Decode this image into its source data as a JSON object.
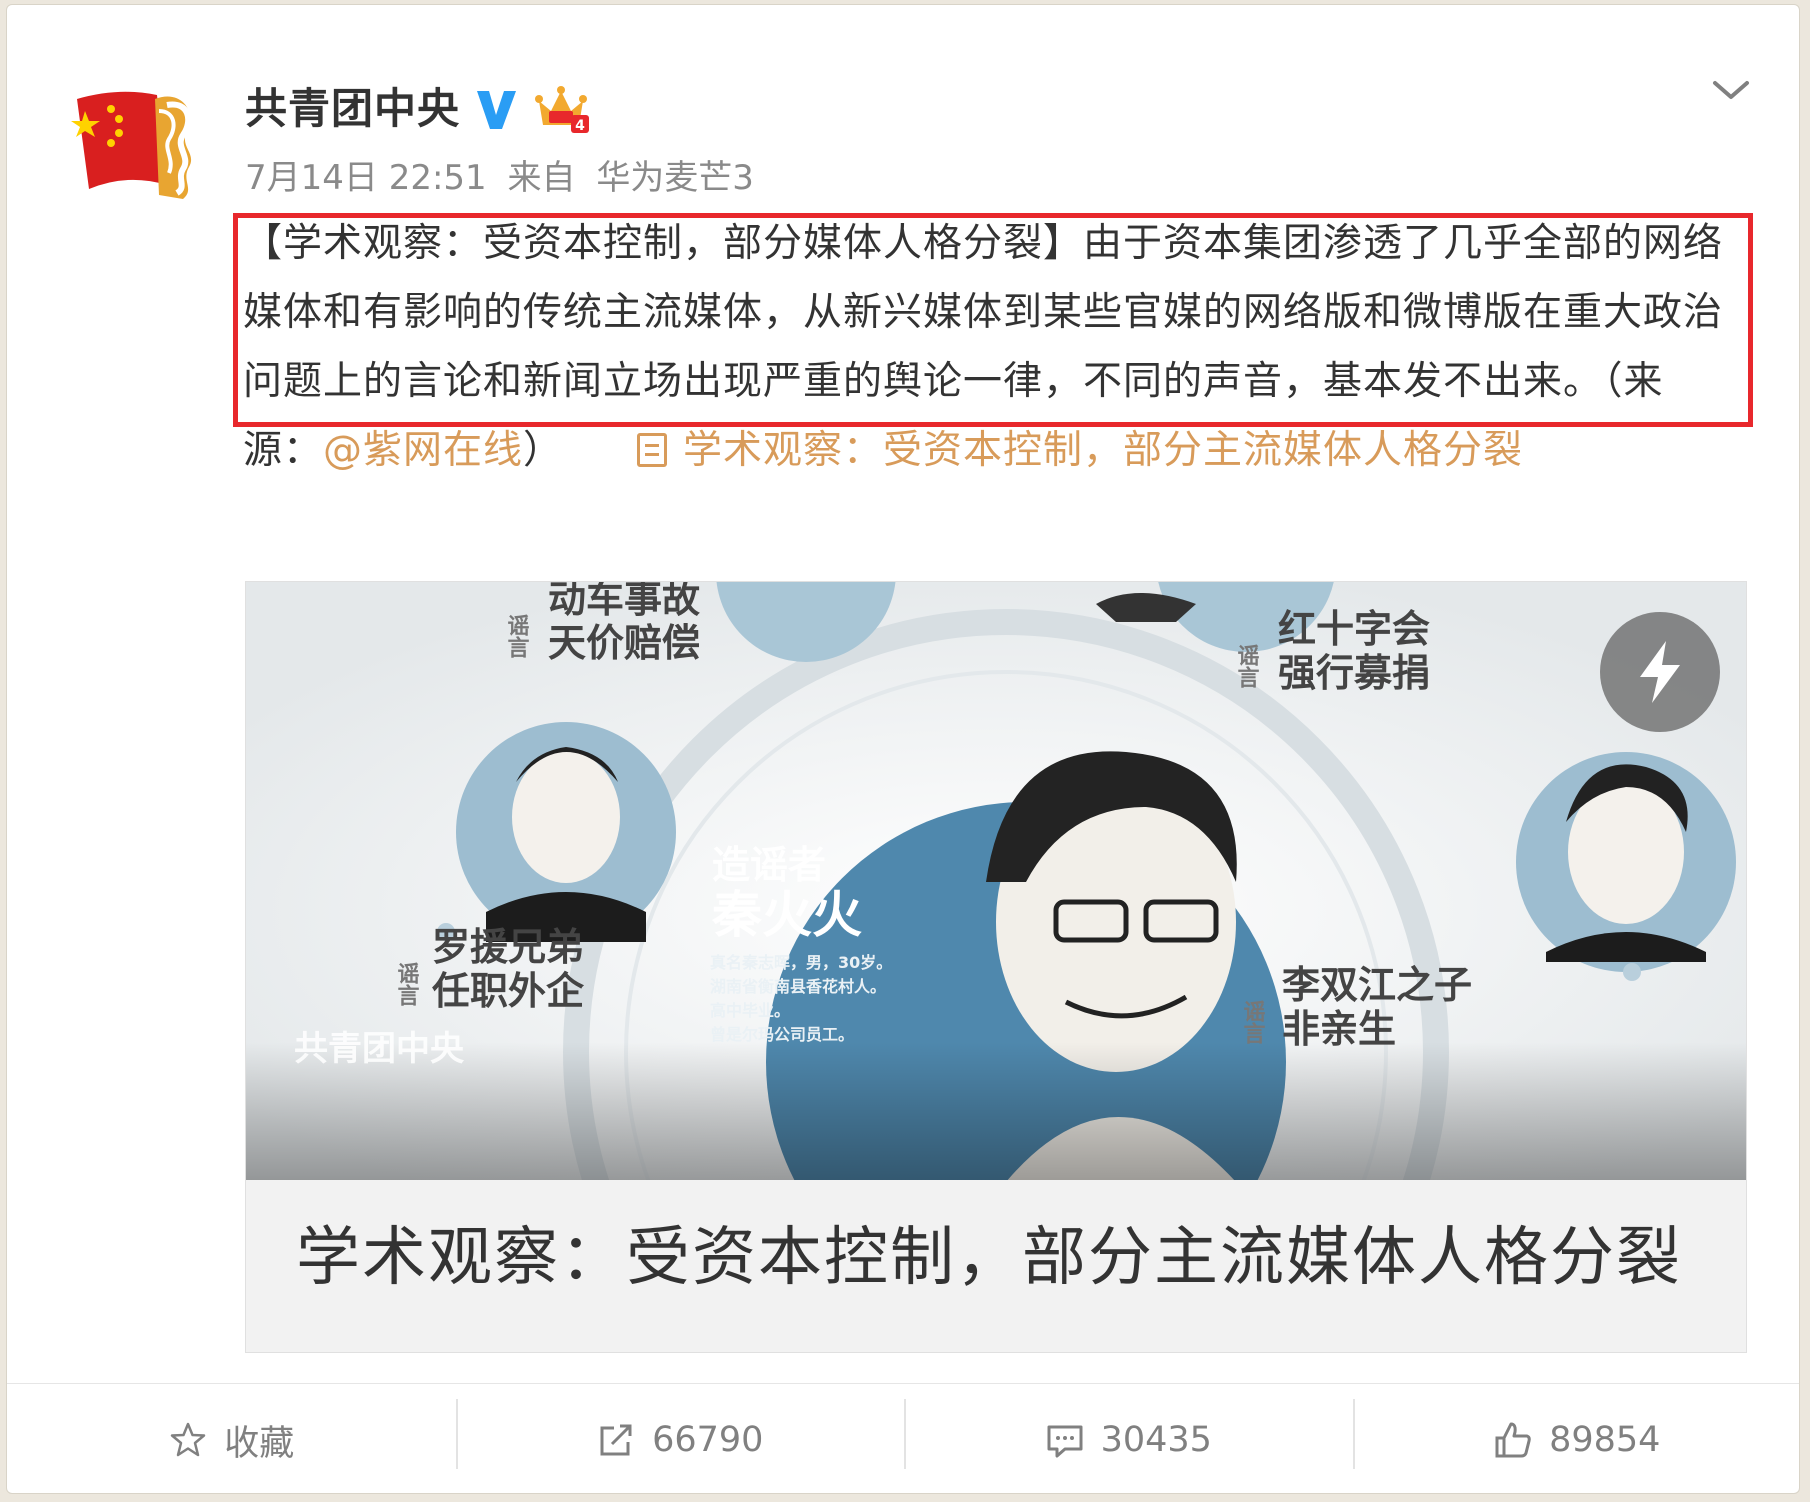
{
  "post": {
    "username": "共青团中央",
    "date": "7月14日 22:51",
    "from_label": "来自",
    "source": "华为麦芒3",
    "text_main": "【学术观察：受资本控制，部分媒体人格分裂】由于资本集团渗透了几乎全部的网络媒体和有影响的传统主流媒体，从新兴媒体到某些官媒的网络版和微博版在重大政治问题上的言论和新闻立场出现严重的舆论一律，不同的声音，基本发不出来。（来源：",
    "mention": "@紫网在线",
    "text_close": "）",
    "article_link": "学术观察：受资本控制，部分主流媒体人格分裂"
  },
  "preview": {
    "title": "学术观察：受资本控制，部分主流媒体人格分裂",
    "watermark": "共青团中央",
    "labels": {
      "rumor": "谣言",
      "top_left": [
        "动车事故",
        "天价赔偿"
      ],
      "top_right": [
        "红十字会",
        "强行募捐"
      ],
      "mid_left": [
        "罗援兄弟",
        "任职外企"
      ],
      "mid_right": [
        "李双江之子",
        "非亲生"
      ],
      "center_title1": "造谣者",
      "center_title2": "秦火火",
      "center_info": [
        "真名秦志晖，男，30岁。",
        "湖南省衡南县香花村人。",
        "高中毕业。",
        "曾是尔玛公司员工。"
      ]
    }
  },
  "actions": {
    "favorite": "收藏",
    "repost": "66790",
    "comment": "30435",
    "like": "89854"
  },
  "colors": {
    "link": "#d89b5a",
    "highlight_border": "#e8282c",
    "verified_blue": "#2a9df4"
  },
  "icons": [
    "chevron-down-icon",
    "verified-v-icon",
    "crown-icon",
    "article-icon",
    "flash-icon",
    "star-icon",
    "repost-icon",
    "comment-icon",
    "thumbs-up-icon"
  ]
}
